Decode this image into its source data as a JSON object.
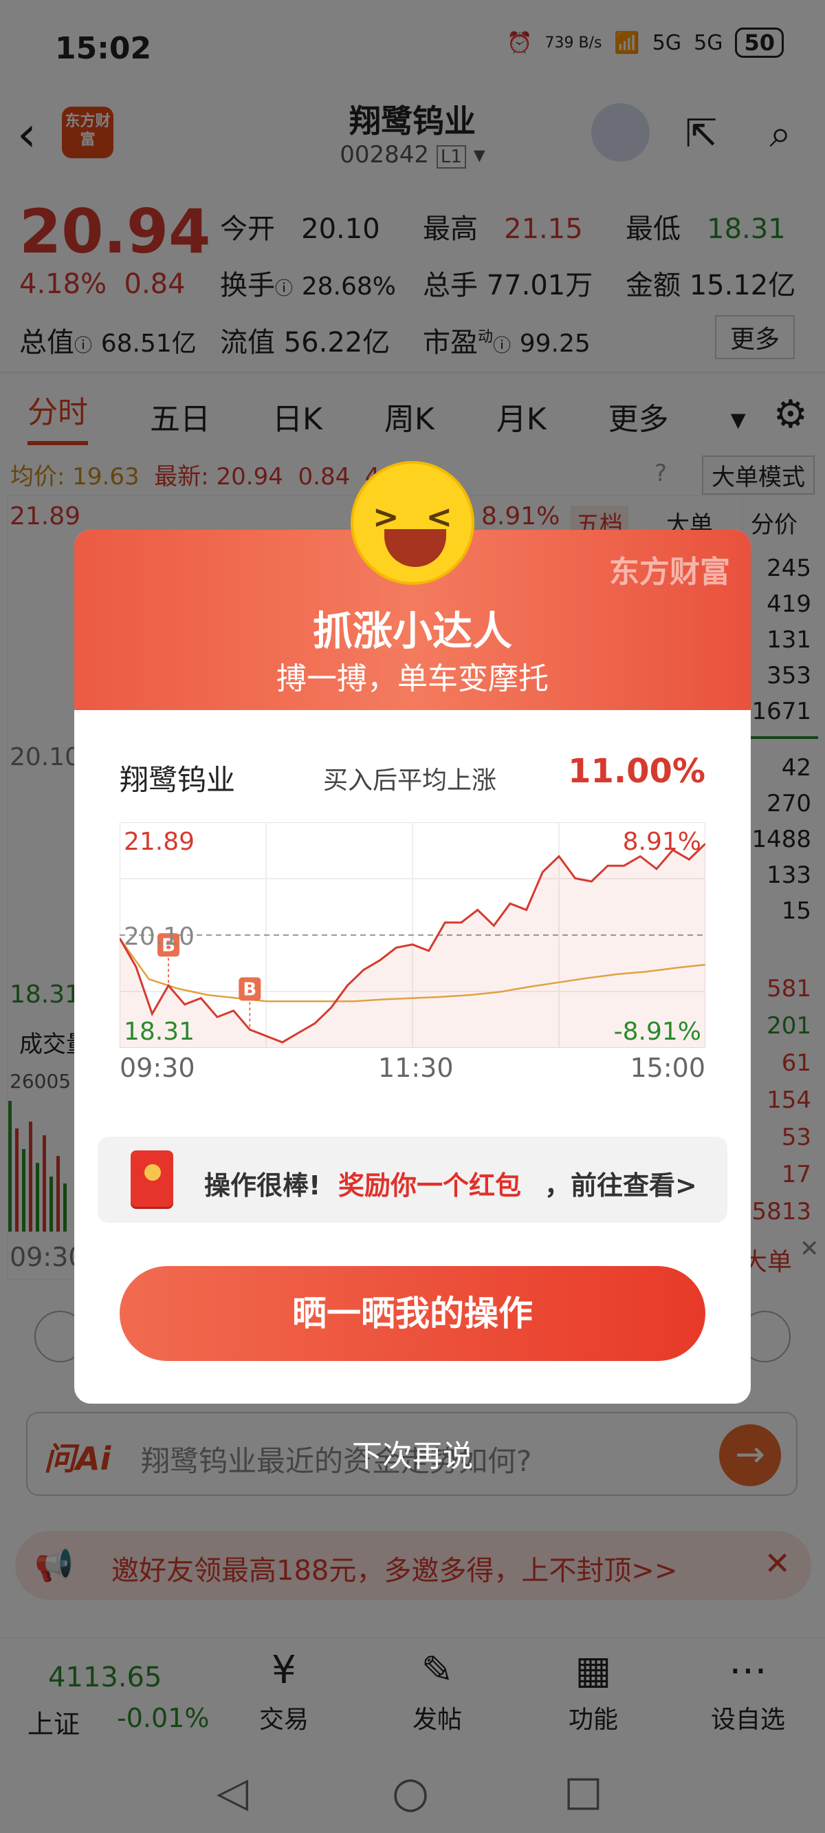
{
  "status_bar": {
    "time": "15:02",
    "net_speed": "739 B/s",
    "signal1": "5G",
    "signal2": "5G",
    "battery": "50"
  },
  "header": {
    "logo": "东方财富",
    "stock_name": "翔鹭钨业",
    "stock_code": "002842",
    "level_badge": "L1"
  },
  "quote": {
    "price": "20.94",
    "change_pct": "4.18%",
    "change_amt": "0.84",
    "open_label": "今开",
    "open": "20.10",
    "high_label": "最高",
    "high": "21.15",
    "low_label": "最低",
    "low": "18.31",
    "turnover_rate_label": "换手",
    "turnover_rate": "28.68%",
    "volume_label": "总手",
    "volume": "77.01万",
    "amount_label": "金额",
    "amount": "15.12亿",
    "mktcap_label": "总值",
    "mktcap": "68.51亿",
    "float_label": "流值",
    "float_cap": "56.22亿",
    "pe_label": "市盈",
    "pe_sup": "动",
    "pe": "99.25",
    "more": "更多"
  },
  "tabs": [
    "分时",
    "五日",
    "日K",
    "周K",
    "月K",
    "更多"
  ],
  "avg_line": {
    "avg_label": "均价:",
    "avg": "19.63",
    "latest_label": "最新:",
    "latest": "20.94",
    "chg": "0.84",
    "pct": "4.18%"
  },
  "mode_button": "大单模式",
  "bg_chart": {
    "top_price": "21.89",
    "top_pct": "8.91%",
    "mid_price": "20.10",
    "low_price": "18.31",
    "vol_label": "成交量",
    "vol_value": "26005",
    "start_time": "09:30"
  },
  "side_panel": {
    "tabs": [
      "五档",
      "大单",
      "分价"
    ],
    "asks": [
      "245",
      "419",
      "131",
      "353",
      "1671"
    ],
    "bids": [
      "42",
      "270",
      "1488",
      "133",
      "15"
    ],
    "ticks": [
      "581",
      "201",
      "61",
      "154",
      "53",
      "17",
      "5813"
    ],
    "bottom": "大单"
  },
  "ai_box": {
    "brand": "问Ai",
    "placeholder": "翔鹭钨业最近的资金走势如何?"
  },
  "promo": {
    "text": "邀好友领最高188元，多邀多得，上不封顶>>"
  },
  "index": {
    "value": "4113.65",
    "name": "上证",
    "change": "-0.01%"
  },
  "nav": [
    {
      "label": "交易",
      "icon": "yen-exchange-icon"
    },
    {
      "label": "发帖",
      "icon": "edit-post-icon"
    },
    {
      "label": "功能",
      "icon": "grid-apps-icon"
    },
    {
      "label": "设自选",
      "icon": "more-dots-icon"
    }
  ],
  "dialog": {
    "brand": "东方财富",
    "title": "抓涨小达人",
    "subtitle": "搏一搏，单车变摩托",
    "stock": "翔鹭钨业",
    "rise_label": "买入后平均上涨",
    "rise_value": "11.00%",
    "redpack_prefix": "操作很棒!",
    "redpack_highlight": "奖励你一个红包",
    "redpack_suffix": "，前往查看>",
    "share_button": "晒一晒我的操作",
    "later": "下次再说"
  },
  "chart_data": {
    "type": "line",
    "title": "",
    "x_labels": [
      "09:30",
      "11:30",
      "15:00"
    ],
    "y_top": "21.89",
    "y_mid": "20.10",
    "y_bottom": "18.31",
    "pct_top": "8.91%",
    "pct_bottom": "-8.91%",
    "ylim": [
      18.31,
      21.89
    ],
    "baseline": 20.1,
    "series": [
      {
        "values": [
          20.05,
          19.6,
          18.85,
          19.3,
          19.0,
          19.1,
          18.8,
          18.9,
          18.6,
          18.5,
          18.4,
          18.55,
          18.7,
          18.95,
          19.3,
          19.55,
          19.7,
          19.9,
          19.95,
          19.85,
          20.3,
          20.3,
          20.5,
          20.25,
          20.6,
          20.5,
          21.1,
          21.35,
          21.0,
          20.95,
          21.2,
          21.2,
          21.35,
          21.15,
          21.45,
          21.3,
          21.55
        ]
      },
      {
        "values": [
          20.05,
          19.4,
          19.25,
          19.15,
          19.1,
          19.05,
          19.05,
          19.05,
          19.05,
          19.08,
          19.1,
          19.12,
          19.15,
          19.2,
          19.28,
          19.35,
          19.42,
          19.48,
          19.52,
          19.58,
          19.63
        ]
      }
    ],
    "buy_markers": [
      {
        "x_index": 3,
        "label": "B"
      },
      {
        "x_index": 8,
        "label": "B"
      }
    ]
  }
}
